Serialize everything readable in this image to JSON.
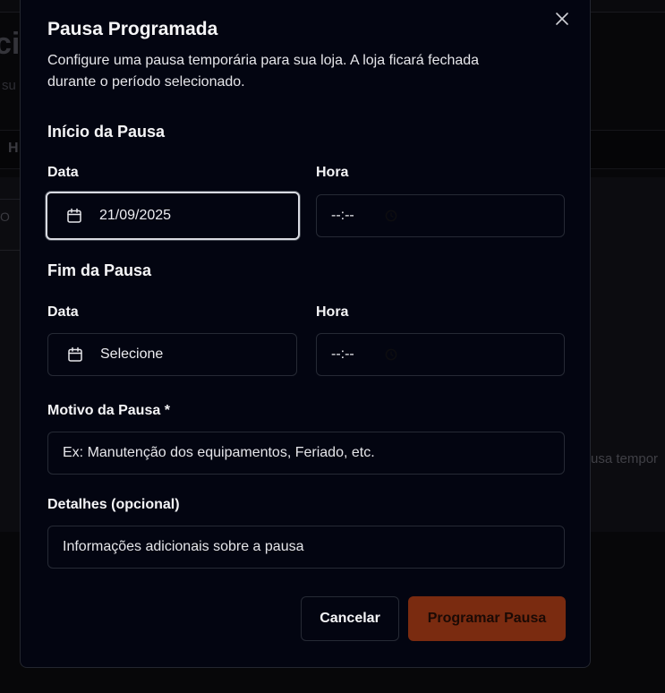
{
  "background": {
    "title_fragment": "ci",
    "subtitle_fragment": "su",
    "tab_fragment": "H",
    "cell_fragment": "O",
    "right_text_fragment": "usa tempor"
  },
  "modal": {
    "title": "Pausa Programada",
    "description": "Configure uma pausa temporária para sua loja. A loja ficará fechada durante o período selecionado.",
    "start_section": {
      "title": "Início da Pausa",
      "date_label": "Data",
      "date_value": "21/09/2025",
      "time_label": "Hora",
      "time_value": "--:--"
    },
    "end_section": {
      "title": "Fim da Pausa",
      "date_label": "Data",
      "date_value": "Selecione",
      "time_label": "Hora",
      "time_value": "--:--"
    },
    "reason": {
      "label": "Motivo da Pausa *",
      "placeholder": "Ex: Manutenção dos equipamentos, Feriado, etc."
    },
    "details": {
      "label": "Detalhes (opcional)",
      "placeholder": "Informações adicionais sobre a pausa"
    },
    "buttons": {
      "cancel": "Cancelar",
      "submit": "Programar Pausa"
    }
  },
  "icons": {
    "close": "close-icon",
    "calendar": "calendar-icon",
    "clock": "clock-icon"
  },
  "colors": {
    "modal_bg": "#030511",
    "border": "#262a35",
    "submit_bg": "#7a2b10",
    "focus_ring": "#d9dbe2"
  }
}
